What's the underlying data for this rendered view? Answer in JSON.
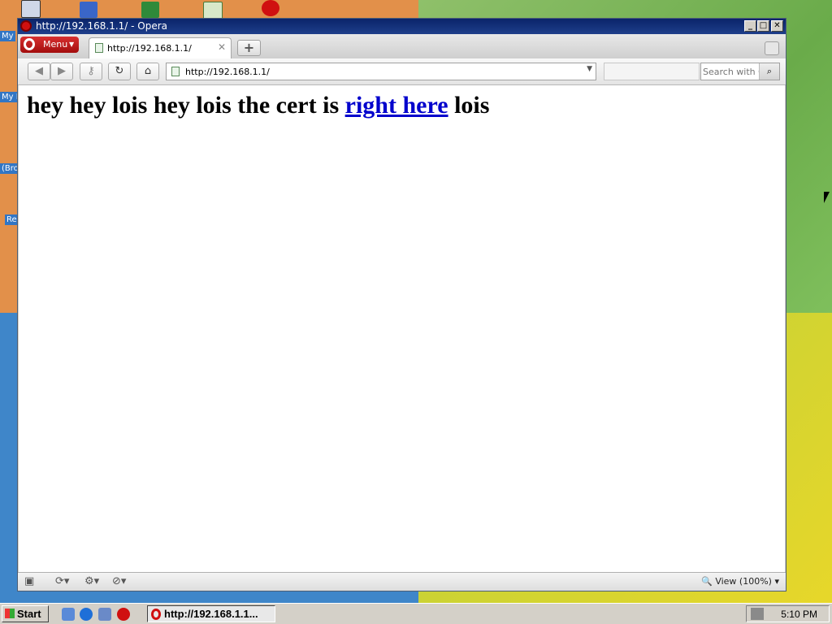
{
  "window": {
    "title": "http://192.168.1.1/ - Opera",
    "controls": {
      "minimize": "_",
      "maximize": "□",
      "close": "✕"
    }
  },
  "menu": {
    "label": "Menu"
  },
  "tabs": [
    {
      "title": "http://192.168.1.1/",
      "active": true
    }
  ],
  "address_bar": {
    "url": "http://192.168.1.1/"
  },
  "search": {
    "placeholder": "Search with Go"
  },
  "page": {
    "heading_before": "hey hey lois hey lois the cert is ",
    "link_text": "right here",
    "heading_after": " lois"
  },
  "statusbar": {
    "zoom_label": "View (100%)"
  },
  "taskbar": {
    "start_label": "Start",
    "window_button": "http://192.168.1.1...",
    "clock": "5:10 PM"
  },
  "desktop_labels": [
    "My",
    "My I",
    "(Bro",
    "Re"
  ],
  "colors": {
    "link": "#0000cc",
    "title_bar": "#0a246a",
    "opera_red": "#d01010"
  }
}
